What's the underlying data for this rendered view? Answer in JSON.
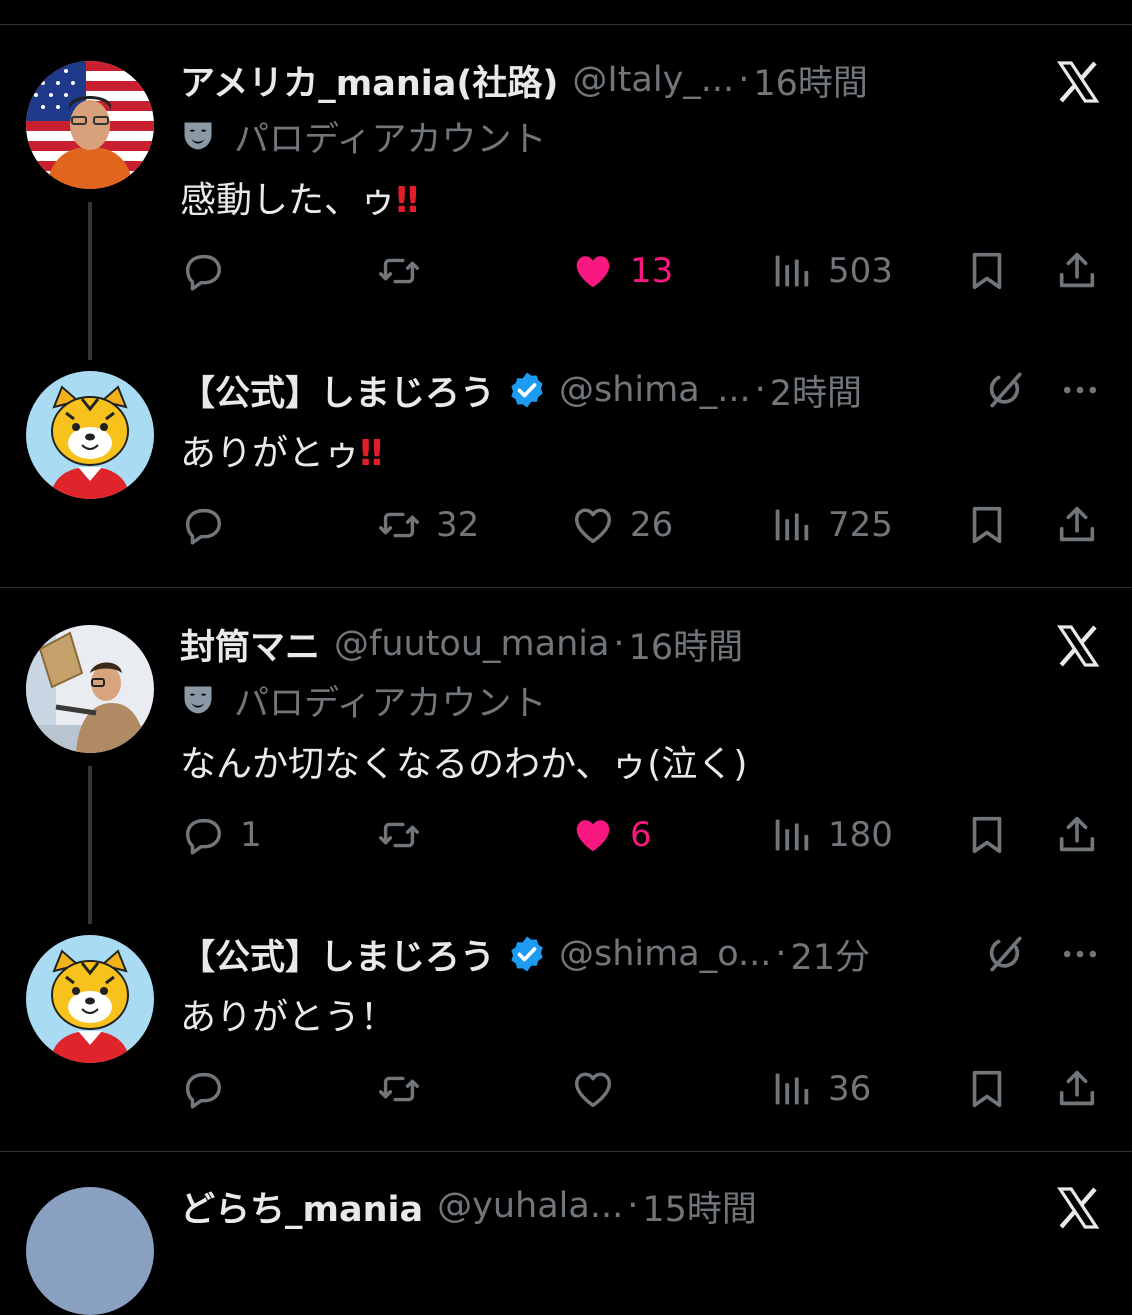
{
  "tweets": [
    {
      "name": "アメリカ_mania(社路)",
      "handle": "@Italy_...",
      "dot": "·",
      "time": "16時間",
      "parody_label": "パロディアカウント",
      "text": "感動した、ゥ",
      "bang": "‼",
      "reply_count": "",
      "retweet_count": "",
      "like_count": "13",
      "views": "503"
    },
    {
      "name": "【公式】しまじろう",
      "handle": "@shima_...",
      "dot": "·",
      "time": "2時間",
      "text": "ありがとゥ",
      "bang": "‼",
      "reply_count": "",
      "retweet_count": "32",
      "like_count": "26",
      "views": "725"
    },
    {
      "name": "封筒マニ",
      "handle": "@fuutou_mania",
      "dot": "·",
      "time": "16時間",
      "parody_label": "パロディアカウント",
      "text": "なんか切なくなるのわか、ゥ(泣く)",
      "reply_count": "1",
      "retweet_count": "",
      "like_count": "6",
      "views": "180"
    },
    {
      "name": "【公式】しまじろう",
      "handle": "@shima_o...",
      "dot": "·",
      "time": "21分",
      "text": "ありがとう！",
      "reply_count": "",
      "retweet_count": "",
      "like_count": "",
      "views": "36"
    },
    {
      "name": "どらち_mania",
      "handle": "@yuhala...",
      "dot": "·",
      "time": "15時間"
    }
  ],
  "colors": {
    "background": "#000000",
    "text": "#e7e9ea",
    "muted": "#71767b",
    "like": "#f91880",
    "verified": "#1d9bf0",
    "exclaim": "#e11d2a"
  },
  "icons": [
    "reply-icon",
    "retweet-icon",
    "like-icon",
    "views-icon",
    "bookmark-icon",
    "share-icon",
    "x-logo-icon",
    "grok-icon",
    "more-icon",
    "parody-mask-icon",
    "verified-badge-icon"
  ]
}
